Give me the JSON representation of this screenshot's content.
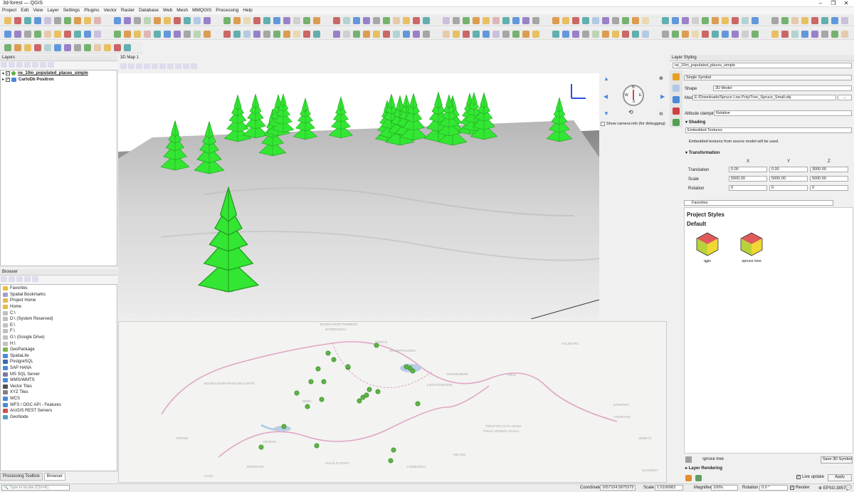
{
  "window": {
    "title": "3d-forest — QGIS"
  },
  "menu": [
    "Project",
    "Edit",
    "View",
    "Layer",
    "Settings",
    "Plugins",
    "Vector",
    "Raster",
    "Database",
    "Web",
    "Mesh",
    "MMQGIS",
    "Processing",
    "Help"
  ],
  "layers_panel": {
    "title": "Layers",
    "items": [
      {
        "label": "ne_10m_populated_places_simple",
        "checked": true,
        "bold": true
      },
      {
        "label": "CartoDb Positron",
        "checked": true,
        "bold": true
      }
    ]
  },
  "browser_panel": {
    "title": "Browser",
    "items": [
      "Favorites",
      "Spatial Bookmarks",
      "Project Home",
      "Home",
      "C:\\",
      "D:\\ (System Reserved)",
      "E:\\",
      "F:\\",
      "G:\\ (Google Drive)",
      "H:\\",
      "GeoPackage",
      "SpatiaLite",
      "PostgreSQL",
      "SAP HANA",
      "MS SQL Server",
      "WMS/WMTS",
      "Vector Tiles",
      "XYZ Tiles",
      "WCS",
      "WFS / OGC API - Features",
      "ArcGIS REST Servers",
      "GeoNode"
    ],
    "tabs": [
      "Processing Toolbox",
      "Browser"
    ]
  },
  "map3d": {
    "title": "3D Map 1",
    "camera_info_label": "Show camera info (for debugging)",
    "compass": {
      "n": "N",
      "s": "S",
      "e": "E",
      "w": "W"
    }
  },
  "map2d": {
    "places": [
      "BADEN-WÜRTTEMBERG",
      "IM BREISGAU",
      "SCHAFFHAUSEN",
      "BOURGOGNE-FRANCHE-COMTÉ",
      "LIECHTENSTEIN",
      "VORARLBERG",
      "TIROL",
      "SALZBURG",
      "KÄRNTEN",
      "CARINTHIA",
      "TRENTINO ALTO ADIGE",
      "FRIULI VENEZIA GIULIA",
      "VALLE D'AOSTA",
      "PIEMONTE",
      "LOMBARDIA",
      "VENETO",
      "SLOVENIA",
      "LYON",
      "GENÈVE",
      "ZÜRICH",
      "BERN",
      "TORINO",
      "MILANO"
    ]
  },
  "styling": {
    "title": "Layer Styling",
    "layer": "ne_10m_populated_places_simple",
    "renderer": "Single Symbol",
    "shape_label": "Shape",
    "shape_value": "3D Model",
    "model_label": "Model",
    "model_value": "E:/Downloads/Spruce Low Poly/Tree_Spruce_Small.obj",
    "altitude_label": "Altitude clamping",
    "altitude_value": "Relative",
    "shading_title": "Shading",
    "shading_value": "Embedded Textures",
    "shading_note": "Embedded textures from source model will be used.",
    "transformation_title": "Transformation",
    "axes": [
      "X",
      "Y",
      "Z"
    ],
    "rows": [
      {
        "label": "Translation",
        "values": [
          "0.00",
          "0.00",
          "3000.00"
        ]
      },
      {
        "label": "Scale",
        "values": [
          "5000.00",
          "5000.00",
          "5000.00"
        ]
      },
      {
        "label": "Rotation",
        "values": [
          "0",
          "0",
          "0"
        ]
      }
    ],
    "search_value": "Favorites",
    "project_styles": "Project Styles",
    "default_group": "Default",
    "styles": [
      "qgis",
      "spruce tree"
    ],
    "symbol_name": "spruce tree",
    "save_button": "Save 3D Symbol...",
    "layer_rendering": "Layer Rendering",
    "live_update": "Live update",
    "apply": "Apply"
  },
  "statusbar": {
    "locate_placeholder": "Type to locate (Ctrl+K)",
    "coordinate_label": "Coordinate",
    "coordinate_value": "1657104,5875373",
    "scale_label": "Scale",
    "scale_value": "1:5100083",
    "magnifier_label": "Magnifier",
    "magnifier_value": "100%",
    "rotation_label": "Rotation",
    "rotation_value": "0.0 °",
    "render_label": "Render",
    "crs": "EPSG:3857"
  },
  "colors": {
    "tree": "#33e633",
    "tree_dark": "#1fa01f",
    "dot": "#5cb345",
    "border": "#e0a6c4"
  }
}
